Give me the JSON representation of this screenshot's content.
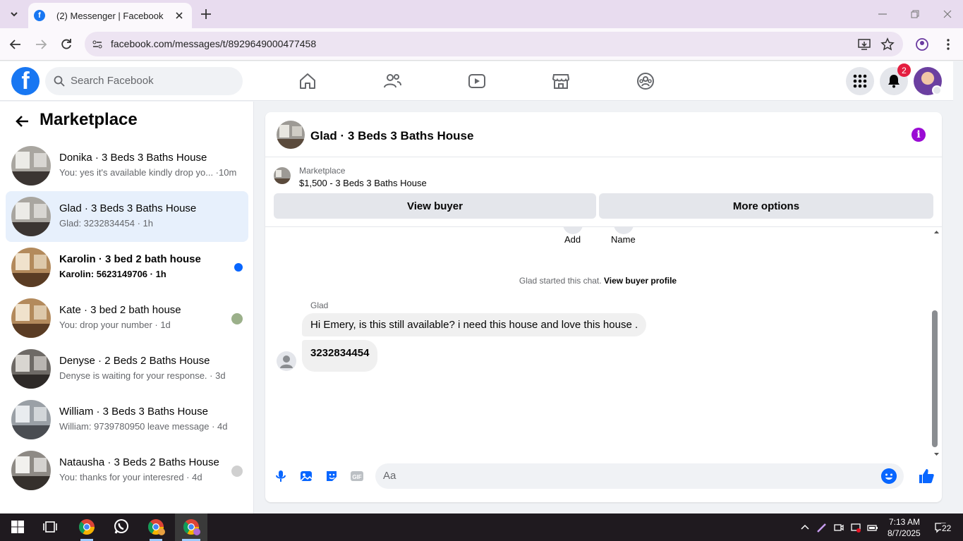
{
  "browser": {
    "tab_title": "(2) Messenger | Facebook",
    "url": "facebook.com/messages/t/8929649000477458"
  },
  "header": {
    "search_placeholder": "Search Facebook",
    "notification_count": "2",
    "nav_icons": [
      "home-icon",
      "friends-icon",
      "video-icon",
      "marketplace-icon",
      "groups-icon"
    ]
  },
  "sidebar": {
    "title": "Marketplace",
    "conversations": [
      {
        "title": "Donika · 3 Beds 3 Baths House",
        "subtitle": "You: yes it's available kindly drop yo... ·10m",
        "unread": false,
        "active": false
      },
      {
        "title": "Glad · 3 Beds 3 Baths House",
        "subtitle": "Glad: 3232834454 · 1h",
        "unread": false,
        "active": true
      },
      {
        "title": "Karolin · 3 bed 2 bath house",
        "subtitle": "Karolin: 5623149706 · 1h",
        "unread": true,
        "active": false
      },
      {
        "title": "Kate · 3 bed 2 bath house",
        "subtitle": "You: drop your number · 1d",
        "unread": false,
        "active": false
      },
      {
        "title": "Denyse · 2 Beds 2 Baths House",
        "subtitle": "Denyse is waiting for your response. · 3d",
        "unread": false,
        "active": false
      },
      {
        "title": "William · 3 Beds 3 Baths House",
        "subtitle": "William: 9739780950 leave message · 4d",
        "unread": false,
        "active": false
      },
      {
        "title": "Natausha · 3 Beds 2 Baths House",
        "subtitle": "You: thanks for your interesred · 4d",
        "unread": false,
        "active": false
      }
    ]
  },
  "chat": {
    "title": "Glad · 3 Beds 3 Baths House",
    "listing_label": "Marketplace",
    "listing_price": "$1,500 - 3 Beds 3 Baths House",
    "view_buyer": "View buyer",
    "more_options": "More options",
    "add_label": "Add",
    "name_label": "Name",
    "started_text": "Glad started this chat.",
    "view_buyer_profile": "View buyer profile",
    "sender": "Glad",
    "messages": [
      "Hi Emery, is this still available? i need this house and love this house .",
      "3232834454"
    ],
    "composer_placeholder": "Aa"
  },
  "taskbar": {
    "time": "7:13 AM",
    "date": "8/7/2025",
    "notifications": "22"
  },
  "colors": {
    "fb_blue": "#1877f2",
    "messenger_blue": "#0866ff",
    "info_purple": "#9a0bd4",
    "badge_red": "#e41e3f"
  }
}
